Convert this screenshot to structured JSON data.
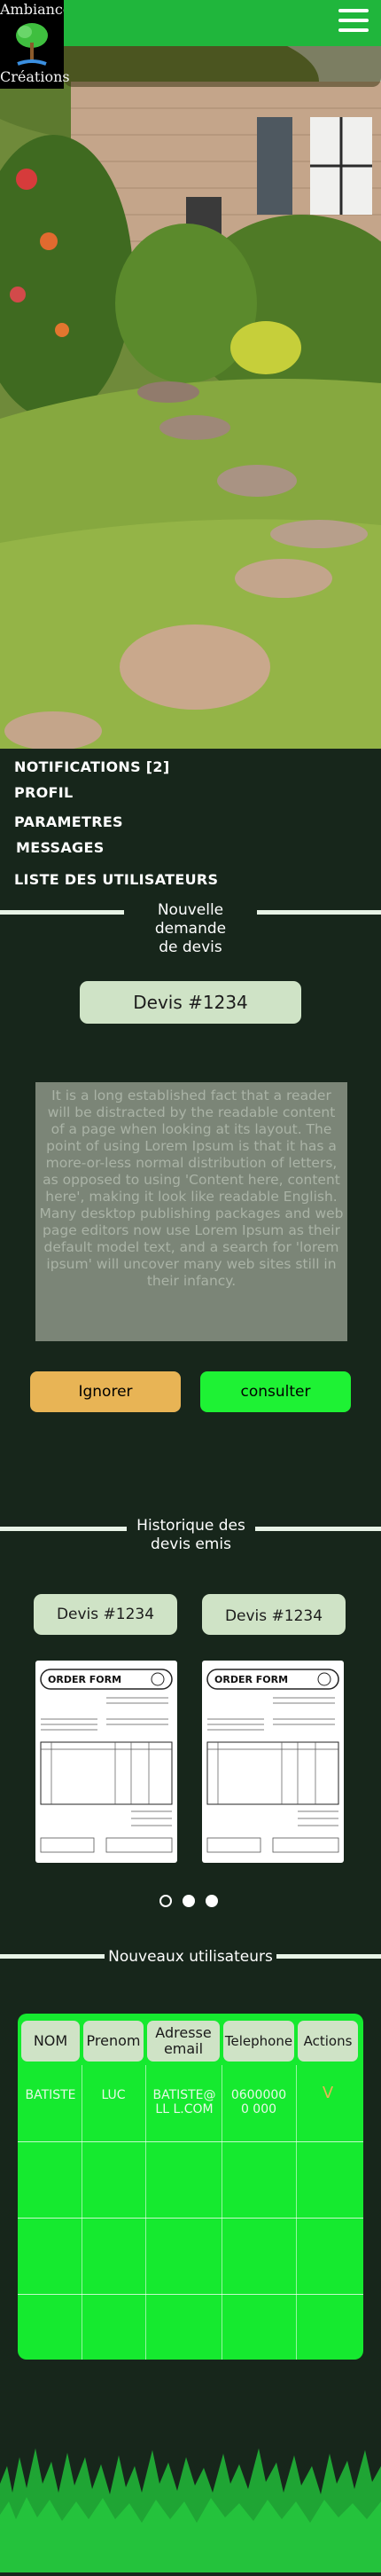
{
  "header": {
    "logo_line1": "Ambiance",
    "logo_line2": "Créations",
    "menu_icon": "hamburger-menu-icon"
  },
  "menu": {
    "notifications": "NOTIFICATIONS [2]",
    "profil": "PROFIL",
    "parametres": "PARAMETRES",
    "messages": "MESSAGES",
    "users": "LISTE DES UTILISATEURS"
  },
  "new_request": {
    "title_line1": "Nouvelle demande",
    "title_line2": "de devis",
    "devis_label": "Devis #1234",
    "body": "It is a long established fact that a reader will be distracted by the readable content of a page when looking at its layout. The point of using Lorem Ipsum is that it has a more-or-less normal distribution of letters, as opposed to using 'Content here, content here', making it look like readable English. Many desktop publishing packages and web page editors now use Lorem Ipsum as their default model text, and a search for 'lorem ipsum' will uncover many web sites still in their infancy.",
    "ignore_label": "Ignorer",
    "consult_label": "consulter"
  },
  "history": {
    "title_line1": "Historique des",
    "title_line2": "devis emis",
    "cards": [
      {
        "label": "Devis #1234",
        "form_title": "ORDER FORM"
      },
      {
        "label": "Devis #1234",
        "form_title": "ORDER FORM"
      }
    ],
    "active_dot": 0
  },
  "users": {
    "title": "Nouveaux utilisateurs",
    "columns": [
      "NOM",
      "Prenom",
      "Adresse email",
      "Telephone",
      "Actions"
    ],
    "rows": [
      {
        "nom": "BATISTE",
        "prenom": "LUC",
        "email": "BATISTE@LL L.COM",
        "tel": "06000000 000",
        "action": "V"
      }
    ]
  },
  "colors": {
    "background": "#17261b",
    "topbar": "#20b63c",
    "pill": "#cfe3c6",
    "ignore": "#e8b455",
    "consult": "#1ef234",
    "table": "#15ea2f",
    "action": "#e8b455"
  }
}
